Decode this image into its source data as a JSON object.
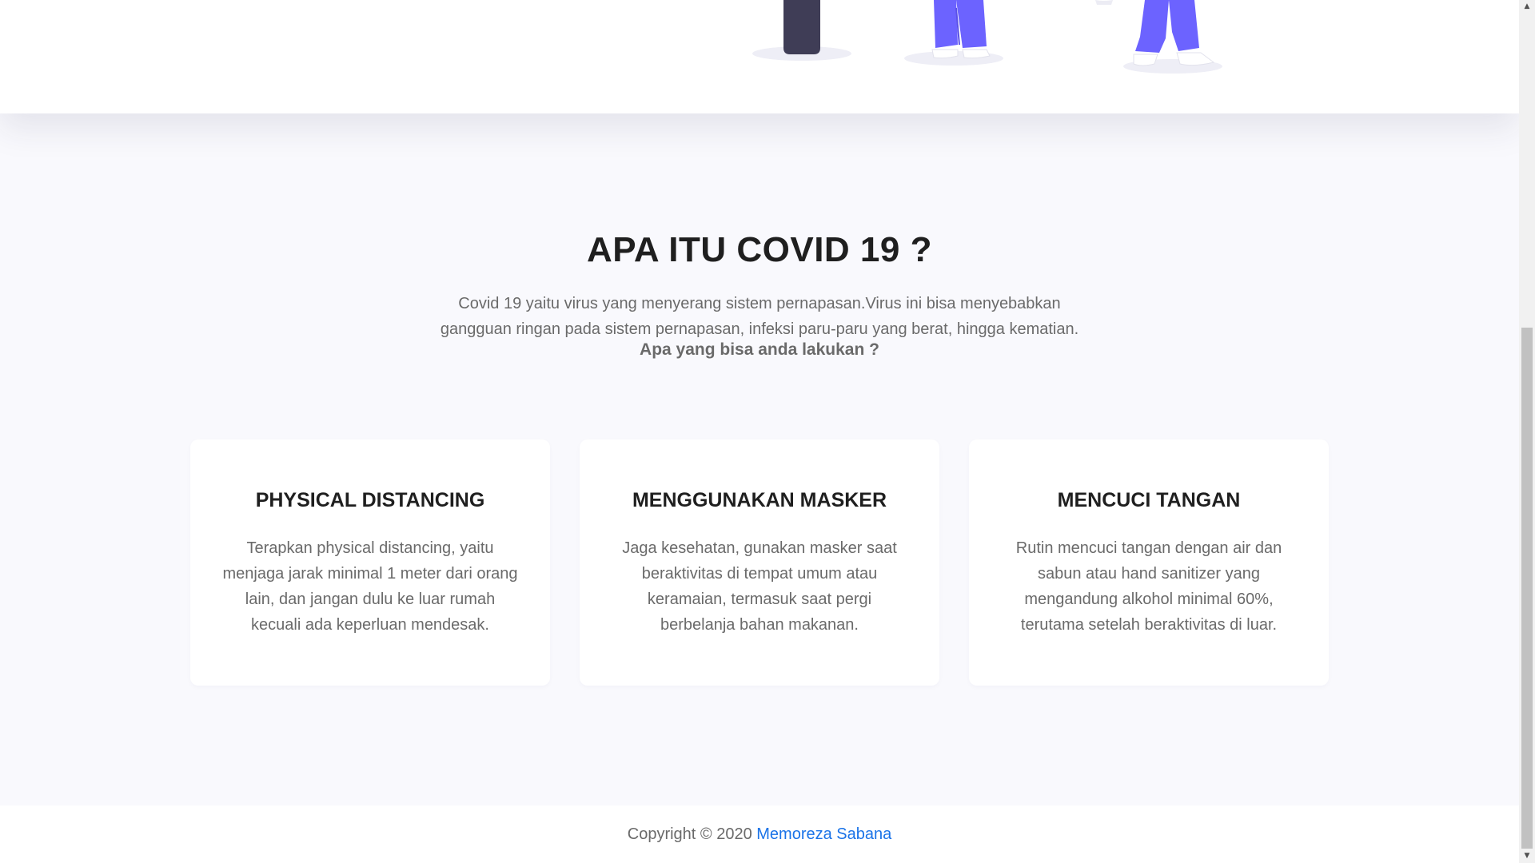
{
  "about": {
    "title": "APA ITU COVID 19 ?",
    "description": "Covid 19 yaitu virus yang menyerang sistem pernapasan.Virus ini bisa menyebabkan gangguan ringan pada sistem pernapasan, infeksi paru-paru yang berat, hingga kematian.",
    "question": "Apa yang bisa anda lakukan ?"
  },
  "cards": [
    {
      "title": "PHYSICAL DISTANCING",
      "text": "Terapkan physical distancing, yaitu menjaga jarak minimal 1 meter dari orang lain, dan jangan dulu ke luar rumah kecuali ada keperluan mendesak."
    },
    {
      "title": "MENGGUNAKAN MASKER",
      "text": "Jaga kesehatan, gunakan masker saat beraktivitas di tempat umum atau keramaian, termasuk saat pergi berbelanja bahan makanan."
    },
    {
      "title": "MENCUCI TANGAN",
      "text": "Rutin mencuci tangan dengan air dan sabun atau hand sanitizer yang mengandung alkohol minimal 60%, terutama setelah beraktivitas di luar."
    }
  ],
  "footer": {
    "copyright": "Copyright © 2020",
    "author_link": "Memoreza Sabana"
  },
  "colors": {
    "heading": "#1f1f1f",
    "body_text": "#6a6a6a",
    "section_bg": "#f9f9fd",
    "illustration_purple": "#6c63ff",
    "illustration_dark": "#3f3d56",
    "link": "#1a73e8"
  },
  "icons": {
    "scroll_up": "triangle-up-icon",
    "scroll_down": "triangle-down-icon"
  }
}
